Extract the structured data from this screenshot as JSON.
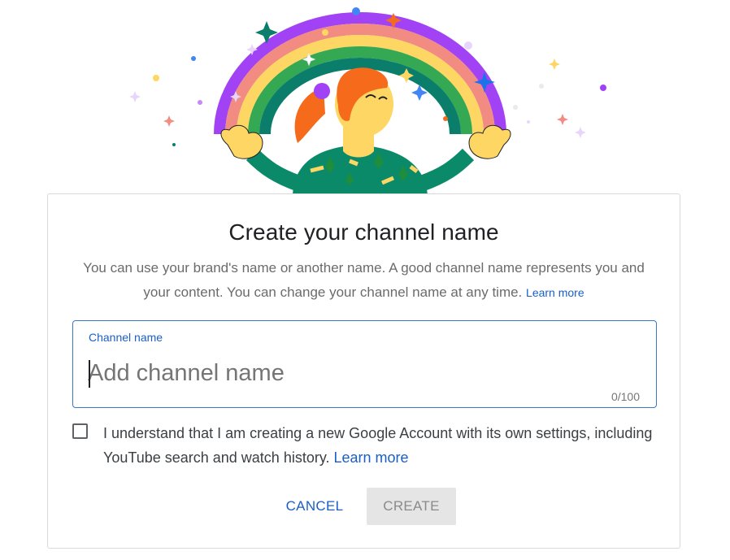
{
  "dialog": {
    "title": "Create your channel name",
    "description": "You can use your brand's name or another name. A good channel name represents you and your content. You can change your channel name at any time.",
    "description_link": "Learn more"
  },
  "channel_name_field": {
    "label": "Channel name",
    "placeholder": "Add channel name",
    "value": "",
    "counter": "0/100"
  },
  "consent": {
    "text": "I understand that I am creating a new Google Account with its own settings, including YouTube search and watch history.",
    "link": "Learn more",
    "checked": false
  },
  "buttons": {
    "cancel": "CANCEL",
    "create": "CREATE"
  },
  "colors": {
    "link_blue": "#1a5fc7",
    "field_border": "#3b78c9",
    "disabled_button_bg": "#e5e5e5"
  }
}
